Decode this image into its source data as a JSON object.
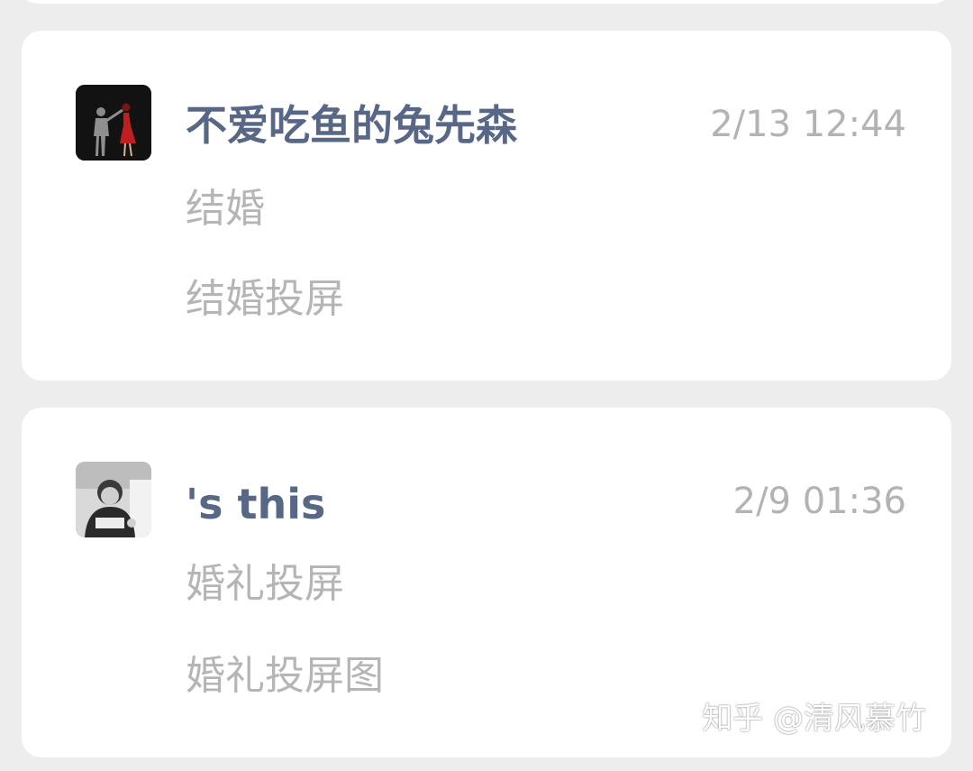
{
  "messages": [
    {
      "name": "不爱吃鱼的兔先森",
      "time": "2/13 12:44",
      "lines": [
        "结婚",
        "结婚投屏"
      ],
      "avatar_icon": "couple-silhouette-icon"
    },
    {
      "name": "'s this",
      "time": "2/9 01:36",
      "lines": [
        "婚礼投屏",
        "婚礼投屏图"
      ],
      "avatar_icon": "child-photo-icon"
    }
  ],
  "watermark": "知乎 @清风慕竹",
  "colors": {
    "background": "#ededed",
    "card": "#ffffff",
    "name": "#586786",
    "text_muted": "#b5b5b5",
    "time": "#b3b3b3"
  }
}
